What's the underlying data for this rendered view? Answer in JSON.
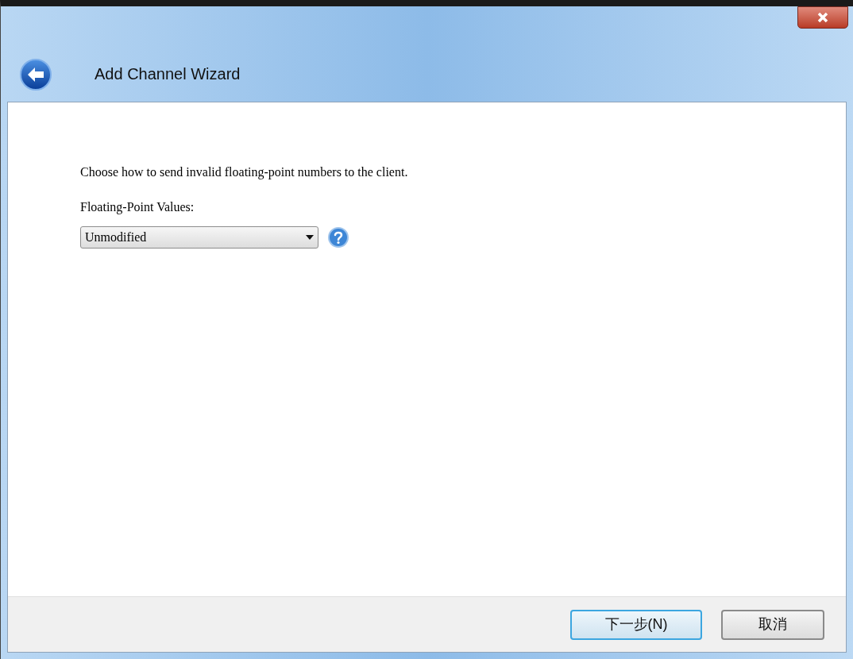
{
  "window": {
    "title": "Add Channel Wizard"
  },
  "content": {
    "instruction": "Choose how to send invalid floating-point numbers to the client.",
    "field_label": "Floating-Point Values:",
    "dropdown": {
      "value": "Unmodified"
    }
  },
  "buttons": [
    {
      "label": "下一步(N)",
      "default": true
    },
    {
      "label": "取消",
      "default": false
    }
  ]
}
